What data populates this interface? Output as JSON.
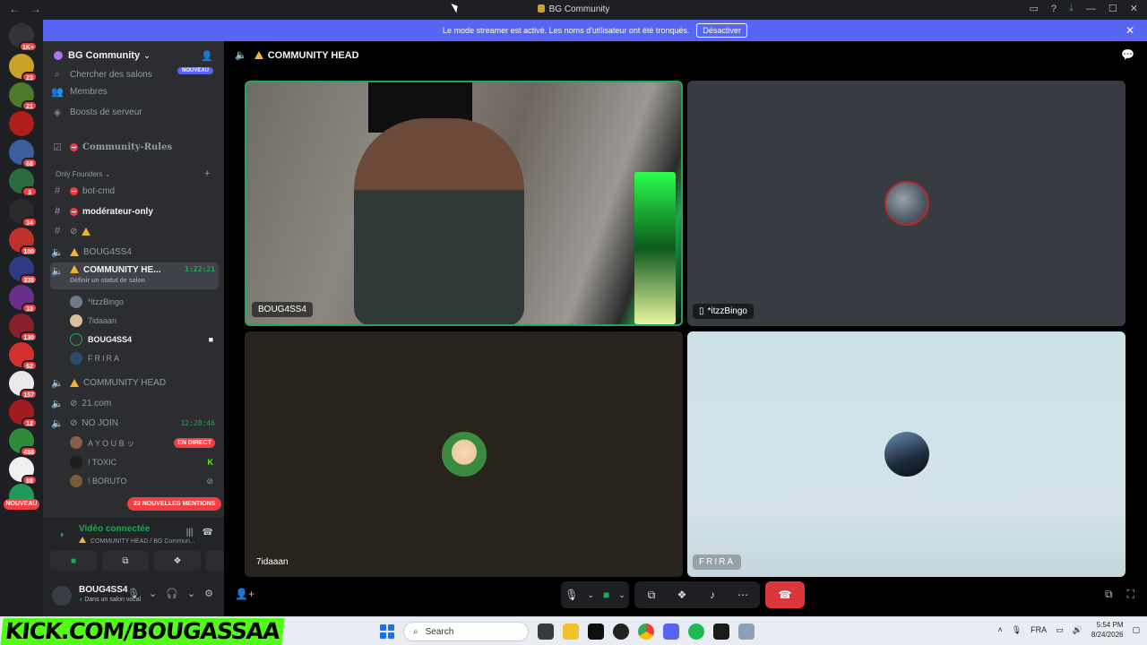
{
  "window": {
    "title": "BG Community"
  },
  "banner": {
    "text": "Le mode streamer est activé. Les noms d'utilisateur ont été tronqués.",
    "button": "Désactiver"
  },
  "rail": {
    "home_badge": "1K+",
    "servers": [
      {
        "badge": "23"
      },
      {
        "badge": "21"
      },
      {
        "badge": ""
      },
      {
        "badge": "68"
      },
      {
        "badge": "3"
      },
      {
        "badge": "34"
      },
      {
        "badge": "100"
      },
      {
        "badge": "338"
      },
      {
        "badge": "33"
      },
      {
        "badge": "130"
      },
      {
        "badge": "62"
      },
      {
        "badge": "157"
      },
      {
        "badge": "12"
      },
      {
        "badge": "488"
      },
      {
        "badge": "88"
      }
    ],
    "nouveau": "NOUVEAU"
  },
  "guild": {
    "name": "BG Community"
  },
  "sidebar": {
    "search": "Chercher des salons",
    "search_tag": "NOUVEAU",
    "members": "Membres",
    "boosts": "Boosts de serveur",
    "rules": "Community-Rules",
    "category": "Only Founders",
    "channels": {
      "bot_cmd": "bot-cmd",
      "moderator": "modérateur-only",
      "boug_voice": "BOUG4SS4",
      "community_head_active": "COMMUNITY HE...",
      "community_head_timer": "1:22:21",
      "status_placeholder": "Définir un statut de salon",
      "community_head2": "COMMUNITY HEAD",
      "site": "21.com",
      "no_join": "NO JOIN",
      "no_join_timer": "12:28:46"
    },
    "voice_users": [
      "*itzzBingo",
      "7idaaan",
      "BOUG4SS4",
      "FRIRA"
    ],
    "no_join_users": [
      "A Y O U B ッ",
      "! TOXIC",
      "! BORUTO"
    ],
    "live_label": "EN DIRECT",
    "mentions": "23 NOUVELLES MENTIONS"
  },
  "voice_panel": {
    "status": "Vidéo connectée",
    "location": "COMMUNITY HEAD / BG Commun..."
  },
  "user_panel": {
    "name": "BOUG4SS4",
    "status": "Dans un salon vocal"
  },
  "call": {
    "channel_title": "COMMUNITY HEAD",
    "tiles": [
      {
        "name": "BOUG4SS4"
      },
      {
        "name": "*itzzBingo"
      },
      {
        "name": "7idaaan"
      },
      {
        "name": "FRIRA"
      }
    ]
  },
  "taskbar": {
    "overlay_text": "KICK.COM/BOUGASSAA",
    "search_placeholder": "Search",
    "lang": "FRA",
    "time": "5:54 PM",
    "date": "8/24/2026"
  },
  "colors": {
    "accent": "#5865f2",
    "online": "#23a55a",
    "danger": "#f23f43",
    "warn": "#f0b232",
    "kick": "#53fc18"
  },
  "icons": [
    "back-arrow-icon",
    "forward-arrow-icon",
    "inbox-icon",
    "help-icon",
    "download-icon",
    "minimize-icon",
    "maximize-icon",
    "close-icon",
    "speaker-icon",
    "hash-icon",
    "camera-icon",
    "mic-icon",
    "headset-icon",
    "gear-icon",
    "hangup-icon",
    "screen-share-icon",
    "activity-icon",
    "soundboard-icon",
    "more-icon",
    "popout-icon",
    "fullscreen-icon",
    "chat-icon"
  ]
}
